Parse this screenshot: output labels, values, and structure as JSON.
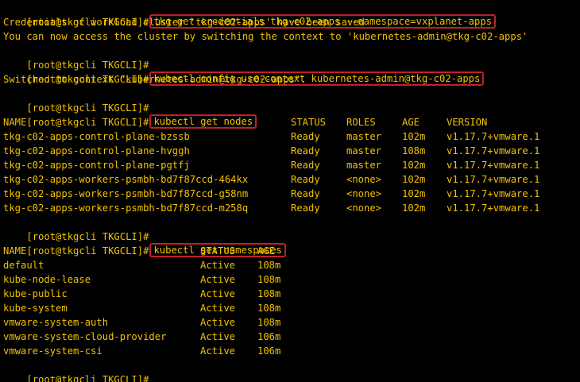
{
  "prompt": "[root@tkgcli TKGCLI]#",
  "colors": {
    "background": "#000000",
    "text": "#f2c200",
    "highlight_border": "#c0202a",
    "cursor": "#19d219"
  },
  "commands": {
    "get_credentials": "tkg get credentials tkg-c02-apps --namespace=vxplanet-apps",
    "use_context": "kubectl config use-context kubernetes-admin@tkg-c02-apps",
    "get_nodes": "kubectl get nodes",
    "get_namespaces": "kubectl get namespaces"
  },
  "outputs": {
    "credentials_saved": "Credentials of workload cluster 'tkg-c02-apps' have been saved",
    "access_hint": "You can now access the cluster by switching the context to 'kubernetes-admin@tkg-c02-apps'",
    "switched": "Switched to context \"kubernetes-admin@tkg-c02-apps\"."
  },
  "nodes": {
    "headers": [
      "NAME",
      "STATUS",
      "ROLES",
      "AGE",
      "VERSION"
    ],
    "rows": [
      [
        "tkg-c02-apps-control-plane-bzssb",
        "Ready",
        "master",
        "102m",
        "v1.17.7+vmware.1"
      ],
      [
        "tkg-c02-apps-control-plane-hvggh",
        "Ready",
        "master",
        "108m",
        "v1.17.7+vmware.1"
      ],
      [
        "tkg-c02-apps-control-plane-pgtfj",
        "Ready",
        "master",
        "102m",
        "v1.17.7+vmware.1"
      ],
      [
        "tkg-c02-apps-workers-psmbh-bd7f87ccd-464kx",
        "Ready",
        "<none>",
        "102m",
        "v1.17.7+vmware.1"
      ],
      [
        "tkg-c02-apps-workers-psmbh-bd7f87ccd-g58nm",
        "Ready",
        "<none>",
        "102m",
        "v1.17.7+vmware.1"
      ],
      [
        "tkg-c02-apps-workers-psmbh-bd7f87ccd-m258q",
        "Ready",
        "<none>",
        "102m",
        "v1.17.7+vmware.1"
      ]
    ]
  },
  "namespaces": {
    "headers": [
      "NAME",
      "STATUS",
      "AGE"
    ],
    "rows": [
      [
        "default",
        "Active",
        "108m"
      ],
      [
        "kube-node-lease",
        "Active",
        "108m"
      ],
      [
        "kube-public",
        "Active",
        "108m"
      ],
      [
        "kube-system",
        "Active",
        "108m"
      ],
      [
        "vmware-system-auth",
        "Active",
        "108m"
      ],
      [
        "vmware-system-cloud-provider",
        "Active",
        "106m"
      ],
      [
        "vmware-system-csi",
        "Active",
        "106m"
      ]
    ]
  }
}
